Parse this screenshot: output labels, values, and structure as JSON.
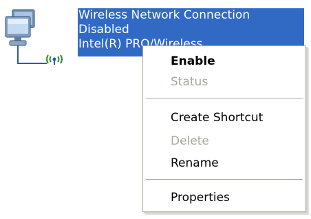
{
  "connection": {
    "name": "Wireless Network Connection",
    "status": "Disabled",
    "adapter": "Intel(R) PRO/Wireless",
    "icon": "wireless-network-connection-icon"
  },
  "context_menu": {
    "items": [
      {
        "label": "Enable",
        "default": true,
        "enabled": true
      },
      {
        "label": "Status",
        "enabled": false
      },
      {
        "label": "Create Shortcut",
        "enabled": true
      },
      {
        "label": "Delete",
        "enabled": false
      },
      {
        "label": "Rename",
        "enabled": true
      },
      {
        "label": "Properties",
        "enabled": true
      }
    ]
  },
  "colors": {
    "selection": "#316ac5",
    "disabled_text": "#aca899",
    "menu_border": "#aca899"
  }
}
